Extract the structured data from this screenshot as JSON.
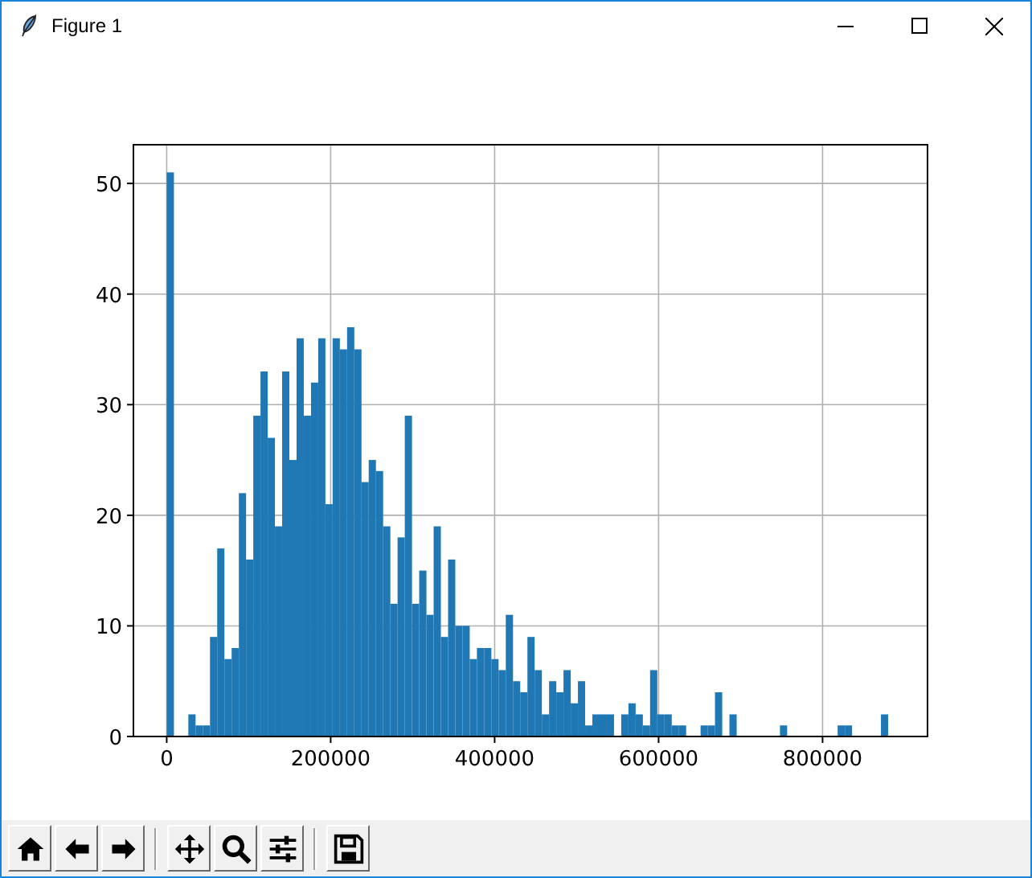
{
  "window": {
    "title": "Figure 1"
  },
  "figure": {
    "chart_data": {
      "type": "bar",
      "x": [
        4400,
        13200,
        22000,
        30800,
        39600,
        48400,
        57200,
        66000,
        74800,
        83600,
        92400,
        101200,
        110000,
        118800,
        127600,
        136400,
        145200,
        154000,
        162800,
        171600,
        180400,
        189200,
        198000,
        206800,
        215600,
        224400,
        233200,
        242000,
        250800,
        259600,
        268400,
        277200,
        286000,
        294800,
        303600,
        312400,
        321200,
        330000,
        338800,
        347600,
        356400,
        365200,
        374000,
        382800,
        391600,
        400400,
        409200,
        418000,
        426800,
        435600,
        444400,
        453200,
        462000,
        470800,
        479600,
        488400,
        497200,
        506000,
        514800,
        523600,
        532400,
        541200,
        550000,
        558800,
        567600,
        576400,
        585200,
        594000,
        602800,
        611600,
        620400,
        629200,
        638000,
        646800,
        655600,
        664400,
        673200,
        682000,
        690800,
        699600,
        708400,
        717200,
        726000,
        734800,
        743600,
        752400,
        761200,
        770000,
        778800,
        787600,
        796400,
        805200,
        814000,
        822800,
        831600,
        840400,
        849200,
        858000,
        866800,
        875600
      ],
      "series": [
        {
          "color": "#1f77b4",
          "values": [
            51,
            0,
            0,
            2,
            1,
            1,
            9,
            17,
            7,
            8,
            22,
            16,
            29,
            33,
            27,
            19,
            33,
            25,
            36,
            29,
            32,
            36,
            21,
            36,
            35,
            37,
            35,
            23,
            25,
            24,
            19,
            12,
            18,
            29,
            12,
            15,
            11,
            19,
            9,
            16,
            10,
            10,
            7,
            8,
            8,
            7,
            6,
            11,
            5,
            4,
            9,
            6,
            2,
            5,
            4,
            6,
            3,
            5,
            1,
            2,
            2,
            2,
            0,
            2,
            3,
            2,
            1,
            6,
            2,
            2,
            1,
            1,
            0,
            0,
            1,
            1,
            4,
            0,
            2,
            0,
            0,
            0,
            0,
            0,
            0,
            1,
            0,
            0,
            0,
            0,
            0,
            0,
            0,
            1,
            1,
            0,
            0,
            0,
            0,
            2
          ]
        }
      ],
      "grid": true,
      "xlim": [
        -40600,
        928000
      ],
      "ylim": [
        0,
        53.5
      ],
      "xticks": [
        0,
        200000,
        400000,
        600000,
        800000
      ],
      "yticks": [
        0,
        10,
        20,
        30,
        40,
        50
      ]
    }
  },
  "toolbar": {
    "buttons": [
      {
        "kind": "home"
      },
      {
        "kind": "back"
      },
      {
        "kind": "forward"
      },
      {
        "kind": "separator"
      },
      {
        "kind": "pan"
      },
      {
        "kind": "zoom"
      },
      {
        "kind": "configure"
      },
      {
        "kind": "separator"
      },
      {
        "kind": "save"
      }
    ]
  }
}
